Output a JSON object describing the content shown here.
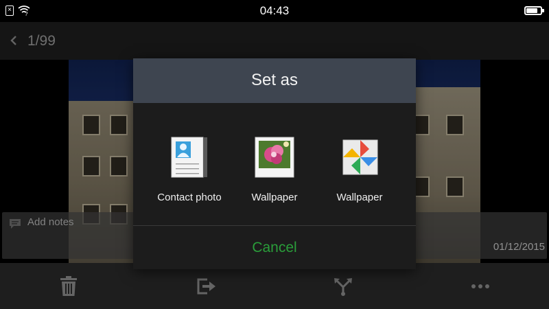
{
  "status_bar": {
    "time": "04:43",
    "icons": [
      "sim-error-icon",
      "wifi-unknown-icon",
      "battery-icon"
    ],
    "battery_level": 0.8
  },
  "app_bar": {
    "back_icon": "chevron-left-icon",
    "counter": "1/99"
  },
  "notes": {
    "placeholder": "Add notes",
    "icon": "comment-icon",
    "date": "01/12/2015"
  },
  "toolbar": {
    "items": [
      {
        "name": "delete",
        "icon": "trash-icon"
      },
      {
        "name": "export",
        "icon": "export-icon"
      },
      {
        "name": "share",
        "icon": "share-icon"
      },
      {
        "name": "more",
        "icon": "more-icon"
      }
    ]
  },
  "dialog": {
    "title": "Set as",
    "options": [
      {
        "label": "Contact photo",
        "icon": "contact-card-icon"
      },
      {
        "label": "Wallpaper",
        "icon": "flower-wallpaper-icon"
      },
      {
        "label": "Wallpaper",
        "icon": "pinwheel-photos-icon"
      }
    ],
    "cancel_label": "Cancel",
    "colors": {
      "header": "#3e4550",
      "cancel": "#2a9d3a",
      "body": "#1c1c1c"
    }
  }
}
